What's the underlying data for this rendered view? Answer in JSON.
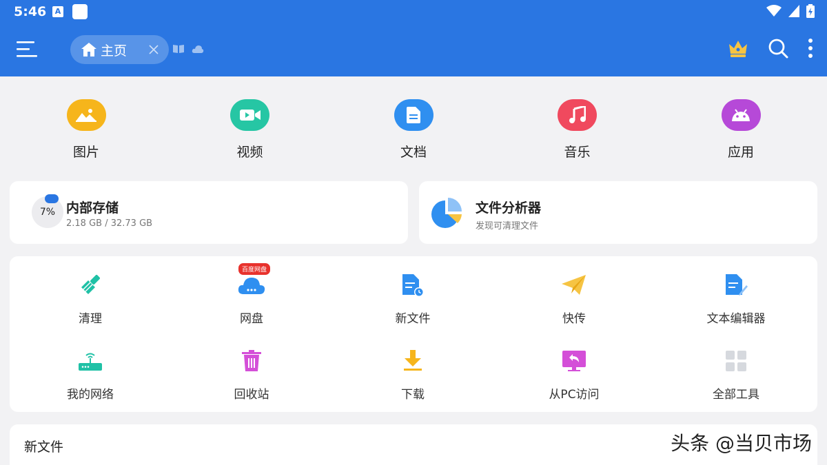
{
  "status_bar": {
    "time": "5:46",
    "notification_letter": "A"
  },
  "header": {
    "tab_label": "主页"
  },
  "categories": [
    {
      "label": "图片",
      "icon": "image-icon",
      "color": "#f6b51b"
    },
    {
      "label": "视频",
      "icon": "video-icon",
      "color": "#26c6a4"
    },
    {
      "label": "文档",
      "icon": "document-icon",
      "color": "#2f8ff0"
    },
    {
      "label": "音乐",
      "icon": "music-icon",
      "color": "#f0495e"
    },
    {
      "label": "应用",
      "icon": "android-icon",
      "color": "#b649d8"
    }
  ],
  "storage": {
    "title": "内部存储",
    "usage": "2.18 GB / 32.73 GB",
    "percent_text": "7%",
    "percent": 7
  },
  "analyzer": {
    "title": "文件分析器",
    "subtitle": "发现可清理文件"
  },
  "tools": [
    {
      "label": "清理",
      "icon": "broom-icon"
    },
    {
      "label": "网盘",
      "icon": "cloud-drive-icon",
      "badge": "百度网盘"
    },
    {
      "label": "新文件",
      "icon": "new-file-icon"
    },
    {
      "label": "快传",
      "icon": "paper-plane-icon"
    },
    {
      "label": "文本编辑器",
      "icon": "text-editor-icon"
    },
    {
      "label": "我的网络",
      "icon": "router-icon"
    },
    {
      "label": "回收站",
      "icon": "trash-icon"
    },
    {
      "label": "下载",
      "icon": "download-icon"
    },
    {
      "label": "从PC访问",
      "icon": "pc-access-icon"
    },
    {
      "label": "全部工具",
      "icon": "grid-icon"
    }
  ],
  "recent": {
    "title": "新文件"
  },
  "watermark": "头条 @当贝市场",
  "colors": {
    "appbar": "#2a76e2",
    "background": "#f2f2f4"
  }
}
